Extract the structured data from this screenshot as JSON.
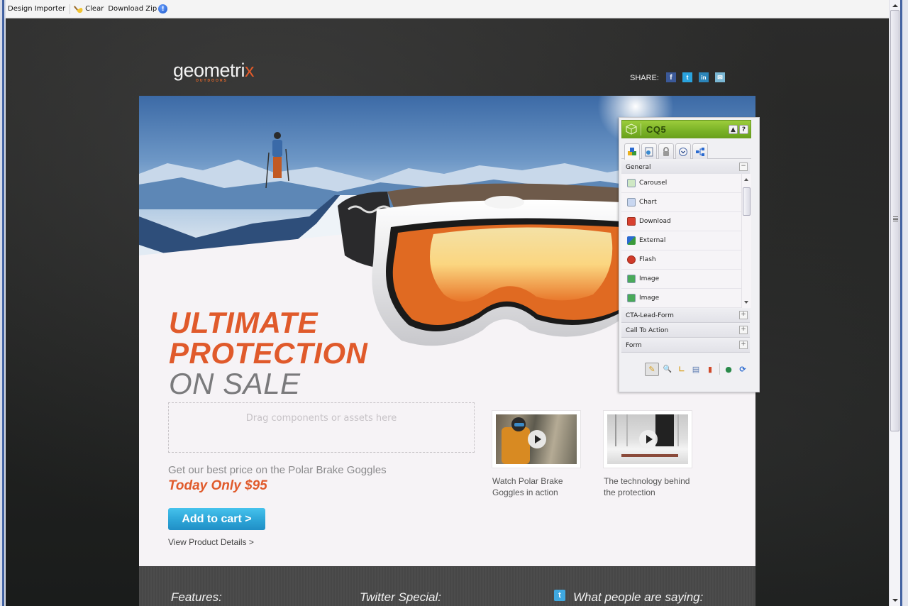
{
  "toolbar": {
    "title": "Design Importer",
    "clear_label": "Clear",
    "download_label": "Download Zip",
    "info_icon": "!"
  },
  "site": {
    "logo_main": "geometri",
    "logo_x": "x",
    "logo_sub": "OUTDOORS",
    "share_label": "SHARE:",
    "social": [
      {
        "name": "facebook",
        "glyph": "f"
      },
      {
        "name": "twitter",
        "glyph": "t"
      },
      {
        "name": "linkedin",
        "glyph": "in"
      },
      {
        "name": "email",
        "glyph": "✉"
      }
    ]
  },
  "hero": {
    "line1": "ULTIMATE",
    "line2": "PROTECTION",
    "line3": "ON SALE"
  },
  "dropzone": {
    "text": "Drag components or assets here"
  },
  "offer": {
    "promo": "Get our best price on the Polar Brake Goggles",
    "price": "Today Only $95",
    "cart_button": "Add to cart  >",
    "details_link": "View Product Details >"
  },
  "videos": [
    {
      "caption": "Watch Polar Brake Goggles in action"
    },
    {
      "caption": "The technology behind the protection"
    }
  ],
  "footer": {
    "features": "Features:",
    "twitter_special": "Twitter Special:",
    "testimonials": "What people are saying:",
    "twitter_glyph": "t"
  },
  "sidekick": {
    "title": "CQ5",
    "minimize": "▲",
    "help": "?",
    "tabs": [
      "components",
      "page",
      "lock",
      "versioning",
      "workflow"
    ],
    "categories": [
      {
        "label": "General",
        "toggle": "−",
        "expanded": true
      },
      {
        "label": "CTA-Lead-Form",
        "toggle": "+",
        "expanded": false
      },
      {
        "label": "Call To Action",
        "toggle": "+",
        "expanded": false
      },
      {
        "label": "Form",
        "toggle": "+",
        "expanded": false
      }
    ],
    "components": [
      {
        "label": "Carousel",
        "color": "#5fa84a"
      },
      {
        "label": "Chart",
        "color": "#4a6fb8"
      },
      {
        "label": "Download",
        "color": "#d84030"
      },
      {
        "label": "External",
        "color": "#3a7ad0"
      },
      {
        "label": "Flash",
        "color": "#d03a2a"
      },
      {
        "label": "Image",
        "color": "#3a9a4a"
      },
      {
        "label": "Image",
        "color": "#3a9a4a"
      }
    ],
    "tools": [
      {
        "name": "edit",
        "glyph": "✎",
        "active": true
      },
      {
        "name": "preview",
        "glyph": "🔍"
      },
      {
        "name": "design",
        "glyph": "∟"
      },
      {
        "name": "scaffolding",
        "glyph": "▤"
      },
      {
        "name": "client-context",
        "glyph": "▮"
      },
      {
        "name": "website",
        "glyph": "●"
      },
      {
        "name": "refresh",
        "glyph": "⟳"
      }
    ]
  },
  "colors": {
    "accent_orange": "#e05a2b",
    "button_blue": "#2ea7d9",
    "cq5_green": "#7ab226"
  }
}
